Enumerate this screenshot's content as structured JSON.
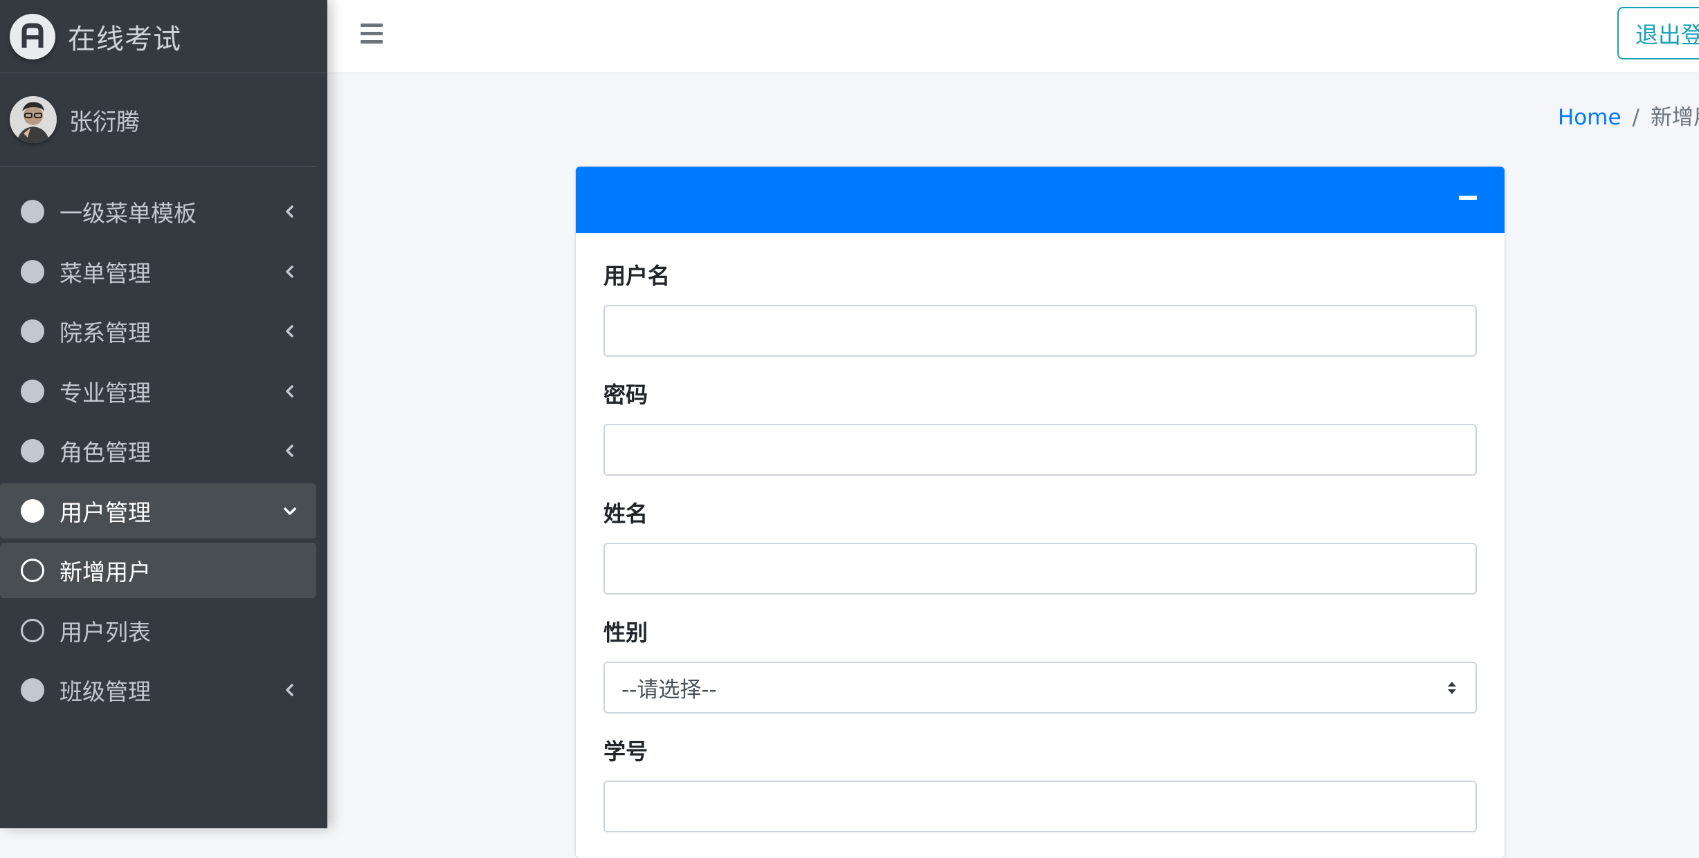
{
  "app": {
    "brand_title": "在线考试",
    "user_name": "张衍腾"
  },
  "sidebar": {
    "items": [
      {
        "label": "一级菜单模板"
      },
      {
        "label": "菜单管理"
      },
      {
        "label": "院系管理"
      },
      {
        "label": "专业管理"
      },
      {
        "label": "角色管理"
      },
      {
        "label": "用户管理"
      },
      {
        "label": "新增用户"
      },
      {
        "label": "用户列表"
      },
      {
        "label": "班级管理"
      }
    ]
  },
  "header": {
    "logout_label": "退出登录"
  },
  "breadcrumb": {
    "home": "Home",
    "separator": "/",
    "current": "新增用户"
  },
  "form": {
    "username_label": "用户名",
    "username_value": "",
    "password_label": "密码",
    "password_value": "",
    "name_label": "姓名",
    "name_value": "",
    "gender_label": "性别",
    "gender_selected": "--请选择--",
    "student_id_label": "学号",
    "student_id_value": ""
  },
  "colors": {
    "sidebar_bg": "#343a40",
    "primary": "#007bff",
    "logout_accent": "#17a2b8",
    "content_bg": "#f4f6f9"
  }
}
